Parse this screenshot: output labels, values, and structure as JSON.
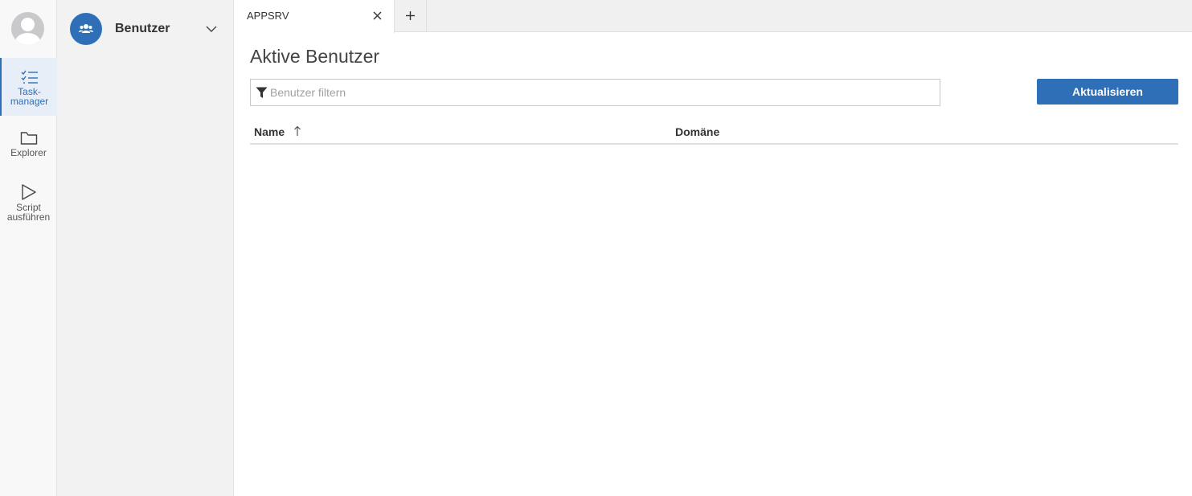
{
  "rail": {
    "items": [
      {
        "label": "Task-\nmanager",
        "icon": "task-list-icon",
        "active": true
      },
      {
        "label": "Explorer",
        "icon": "folder-icon",
        "active": false
      },
      {
        "label": "Script\nausführen",
        "icon": "play-icon",
        "active": false
      }
    ]
  },
  "panel": {
    "title": "Benutzer",
    "icon": "users-icon"
  },
  "tabs": [
    {
      "label": "APPSRV"
    }
  ],
  "main": {
    "title": "Aktive Benutzer",
    "filter_placeholder": "Benutzer filtern",
    "filter_value": "",
    "refresh_label": "Aktualisieren",
    "columns": [
      {
        "label": "Name",
        "sort": "ascending"
      },
      {
        "label": "Domäne"
      }
    ],
    "rows": []
  },
  "colors": {
    "accent": "#2f6fb7",
    "rail_bg": "#f8f8f9",
    "panel_bg": "#f2f2f3"
  }
}
